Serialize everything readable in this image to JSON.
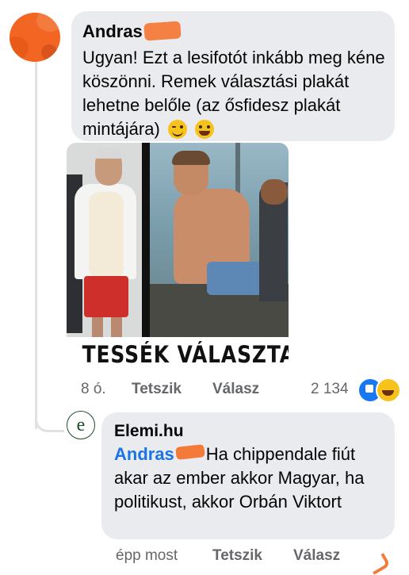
{
  "comment": {
    "author": "Andras",
    "text": "Ugyan! Ezt a lesifotót inkább meg kéne köszönni. Remek választási plakát lehetne belőle (az ősfidesz plakát mintájára)",
    "emojis": [
      "winking-face",
      "grinning-face"
    ],
    "image_caption": "TESSÉK VÁLASZTANI",
    "time": "8 ó.",
    "like_label": "Tetszik",
    "reply_label": "Válasz",
    "reaction_count": "2 134",
    "reactions": [
      "like",
      "haha"
    ]
  },
  "reply": {
    "author": "Elemi.hu",
    "avatar_letter": "e",
    "mention": "Andras",
    "text": "Ha chippendale fiút akar az ember akkor Magyar, ha politikust, akkor Orbán Viktort",
    "time": "épp most",
    "like_label": "Tetszik",
    "reply_label": "Válasz"
  },
  "colors": {
    "bubble": "#e9ebee",
    "meta_text": "#65676b",
    "mention": "#1b74e4",
    "redaction": "#f47a3a",
    "like_blue": "#1877f2"
  }
}
